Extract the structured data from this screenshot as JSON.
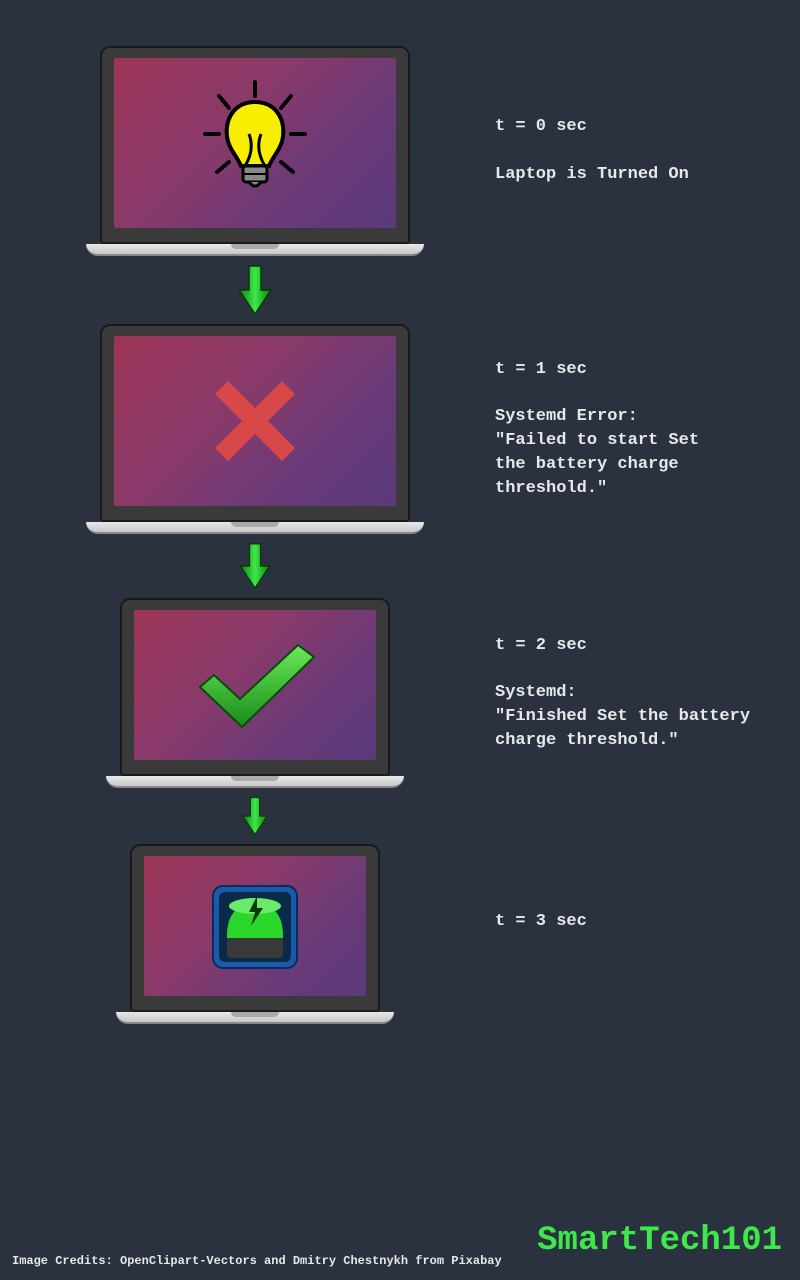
{
  "steps": [
    {
      "time": "t = 0 sec",
      "caption": "Laptop is Turned On",
      "icon": "lightbulb-icon"
    },
    {
      "time": "t = 1 sec",
      "caption": "Systemd Error:\n\"Failed to start Set\nthe battery charge\nthreshold.\"",
      "icon": "cross-icon"
    },
    {
      "time": "t = 2 sec",
      "caption": "Systemd:\n\"Finished Set the battery\n charge threshold.\"",
      "icon": "check-icon"
    },
    {
      "time": "t = 3 sec",
      "caption": "",
      "icon": "battery-charging-icon"
    }
  ],
  "credits": "Image Credits: OpenClipart-Vectors and Dmitry Chestnykh from Pixabay",
  "brand": "SmartTech101"
}
